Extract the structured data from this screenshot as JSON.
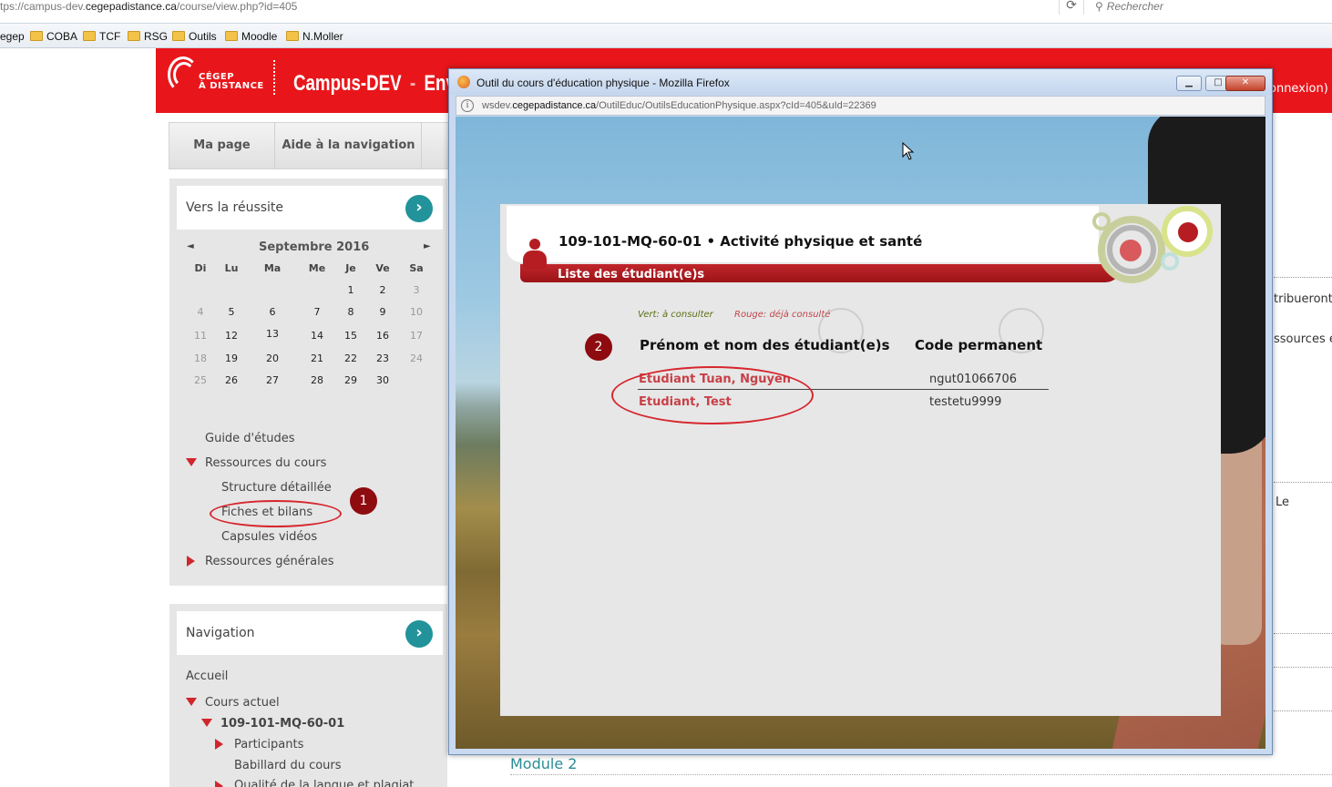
{
  "browser": {
    "url_prefix": "tps://campus-dev.",
    "url_domain": "cegepadistance.ca",
    "url_path": "/course/view.php?id=405",
    "reload_glyph": "⟳",
    "search_placeholder": "Rechercher",
    "bookmarks": [
      "egep",
      "COBA",
      "TCF",
      "RSG",
      "Outils",
      "Moodle",
      "N.Moller"
    ]
  },
  "header": {
    "logo_text_line1": "CÉGEP",
    "logo_text_line2": "À DISTANCE",
    "site_title": "Campus-DEV",
    "site_title_sep": "-",
    "site_title_rest": "Environ",
    "login_fragment": "onnexion)"
  },
  "navbar": {
    "items": [
      "Ma page",
      "Aide à la navigation"
    ]
  },
  "block_reussite": {
    "title": "Vers la réussite",
    "go_glyph": "›",
    "calendar": {
      "prev": "◄",
      "next": "►",
      "month": "Septembre 2016",
      "dow": [
        "Di",
        "Lu",
        "Ma",
        "Me",
        "Je",
        "Ve",
        "Sa"
      ],
      "weeks": [
        [
          "",
          "",
          "",
          "",
          "1",
          "2",
          "3"
        ],
        [
          "4",
          "5",
          "6",
          "7",
          "8",
          "9",
          "10"
        ],
        [
          "11",
          "12",
          "13",
          "14",
          "15",
          "16",
          "17"
        ],
        [
          "18",
          "19",
          "20",
          "21",
          "22",
          "23",
          "24"
        ],
        [
          "25",
          "26",
          "27",
          "28",
          "29",
          "30",
          ""
        ]
      ]
    },
    "menu": {
      "guide": "Guide d'études",
      "ressources_cours": "Ressources du cours",
      "structure": "Structure détaillée",
      "fiches": "Fiches et bilans",
      "capsules": "Capsules vidéos",
      "ressources_generales": "Ressources générales"
    },
    "annotation_1": "1"
  },
  "block_navigation": {
    "title": "Navigation",
    "go_glyph": "›",
    "accueil": "Accueil",
    "cours_actuel": "Cours actuel",
    "course_code": "109-101-MQ-60-01",
    "participants": "Participants",
    "babillard": "Babillard du cours",
    "qualite": "Qualité de la langue et plagiat"
  },
  "right_fragments": {
    "t1": "tribueront",
    "t2": "ssources e",
    "t3": "Le",
    "module2": "Module 2"
  },
  "popup": {
    "title": "Outil du cours d'éducation physique - Mozilla Firefox",
    "min_glyph": "▁",
    "max_glyph": "□",
    "close_glyph": "✕",
    "url_prefix": "wsdev.",
    "url_domain": "cegepadistance.ca",
    "url_path": "/OutilEduc/OutilsEducationPhysique.aspx?cId=405&uId=22369",
    "info_glyph": "i",
    "course_title": "109-101-MQ-60-01 • Activité physique et santé",
    "band_label": "Liste des étudiant(e)s",
    "legend_green": "Vert: à consulter",
    "legend_red": "Rouge: déjà consulté",
    "col_name": "Prénom et nom des étudiant(e)s",
    "col_code": "Code permanent",
    "annotation_2": "2",
    "students": [
      {
        "name": "Etudiant Tuan, Nguyen",
        "code": "ngut01066706"
      },
      {
        "name": "Etudiant, Test",
        "code": "testetu9999"
      }
    ]
  },
  "colors": {
    "brand_red": "#e8161b",
    "teal": "#22939a",
    "student_red": "#c74148",
    "annotation": "#8e0b10"
  }
}
